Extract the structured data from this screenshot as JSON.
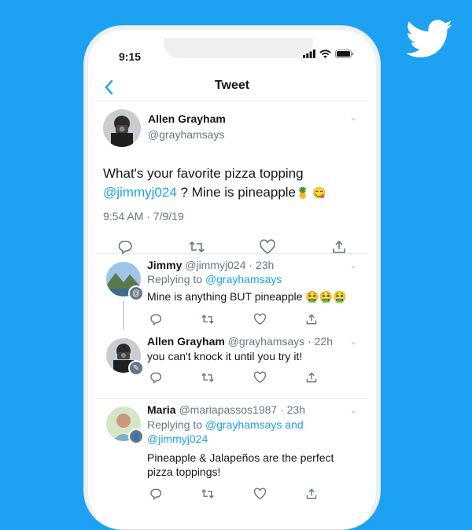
{
  "status": {
    "time": "9:15"
  },
  "nav": {
    "back_icon": "chevron-left-icon",
    "title": "Tweet"
  },
  "tweet": {
    "name": "Allen Grayham",
    "handle": "@grayhamsays",
    "text_before": "What's your favorite pizza topping",
    "mention": "@jimmyj024",
    "text_after": "? Mine is pineapple",
    "emoji": "🍍 😋",
    "timestamp": "9:54 AM · 7/9/19"
  },
  "replies": [
    {
      "name": "Jimmy",
      "handle": "@jimmyj024",
      "time": "· 23h",
      "replying_label": "Replying to",
      "replying_to": "@grayhamsays",
      "text": "Mine is anything BUT pineapple 🤮🤮🤮",
      "badge": "@"
    },
    {
      "name": "Allen Grayham",
      "handle": "@grayhamsays",
      "time": "· 22h",
      "text": "you can't knock it until you try it!",
      "badge": "✎"
    },
    {
      "name": "Maria",
      "handle": "@mariapassos1987",
      "time": "· 23h",
      "replying_label": "Replying to",
      "replying_to": "@grayhamsays and",
      "replying_to_2": "@jimmyj024",
      "text_line1": "Pineapple & Jalapeños are the perfect",
      "text_line2": "pizza toppings!",
      "badge": "👤"
    }
  ],
  "colors": {
    "brand": "#1da1f2",
    "muted": "#657786",
    "border": "#e6ecf0"
  }
}
